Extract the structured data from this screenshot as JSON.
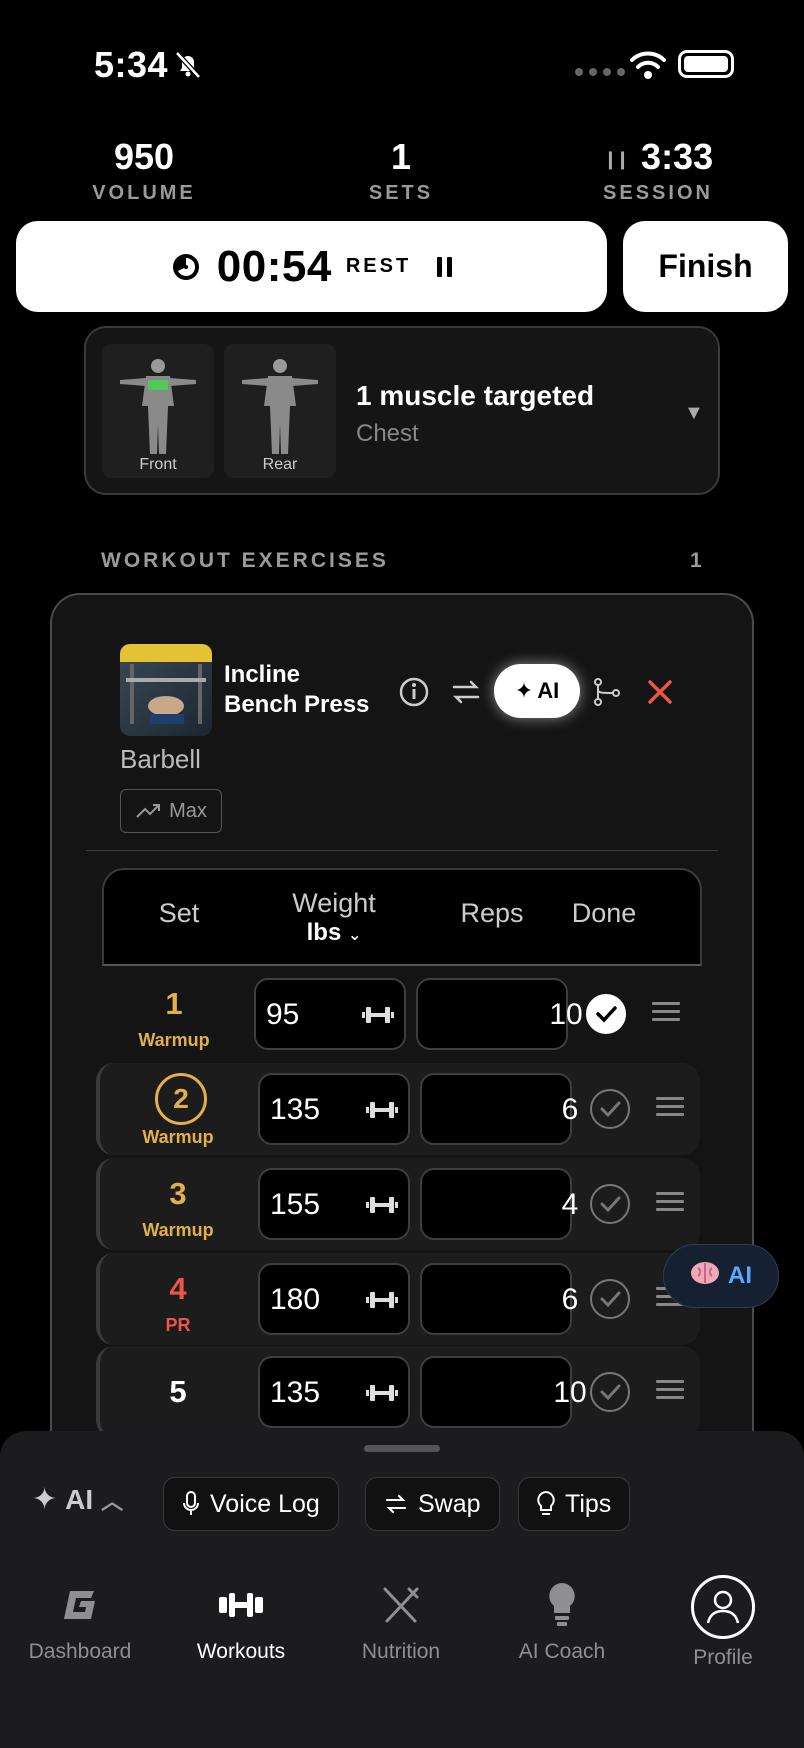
{
  "status_bar": {
    "time": "5:34"
  },
  "stats": [
    {
      "value": "950",
      "label": "VOLUME"
    },
    {
      "value": "1",
      "label": "SETS"
    },
    {
      "value": "3:33",
      "label": "SESSION"
    }
  ],
  "rest": {
    "time": "00:54",
    "label": "REST"
  },
  "finish_label": "Finish",
  "muscles": {
    "front_label": "Front",
    "rear_label": "Rear",
    "title": "1 muscle targeted",
    "subtitle": "Chest"
  },
  "section": {
    "title": "WORKOUT EXERCISES",
    "count": "1"
  },
  "exercise": {
    "name_line1": "Incline",
    "name_line2": "Bench Press",
    "equipment": "Barbell",
    "max_label": "Max",
    "ai_label": "AI"
  },
  "table": {
    "headers": {
      "set": "Set",
      "weight": "Weight",
      "unit": "lbs",
      "reps": "Reps",
      "done": "Done"
    },
    "rows": [
      {
        "set": "1",
        "tag": "Warmup",
        "weight": "95",
        "reps": "10",
        "done": true
      },
      {
        "set": "2",
        "tag": "Warmup",
        "weight": "135",
        "reps": "6",
        "done": false
      },
      {
        "set": "3",
        "tag": "Warmup",
        "weight": "155",
        "reps": "4",
        "done": false
      },
      {
        "set": "4",
        "tag": "PR",
        "weight": "180",
        "reps": "6",
        "done": false
      },
      {
        "set": "5",
        "tag": "",
        "weight": "135",
        "reps": "10",
        "done": false
      }
    ]
  },
  "ai_float_label": "AI",
  "ai_bar": {
    "toggle_label": "AI",
    "chips": [
      "Voice Log",
      "Swap",
      "Tips"
    ]
  },
  "tabs": [
    "Dashboard",
    "Workouts",
    "Nutrition",
    "AI Coach",
    "Profile"
  ],
  "colors": {
    "warmup": "#e2b04a",
    "pr": "#e8574a",
    "accent_blue": "#5aa9ff",
    "remove_red": "#e8574a"
  }
}
